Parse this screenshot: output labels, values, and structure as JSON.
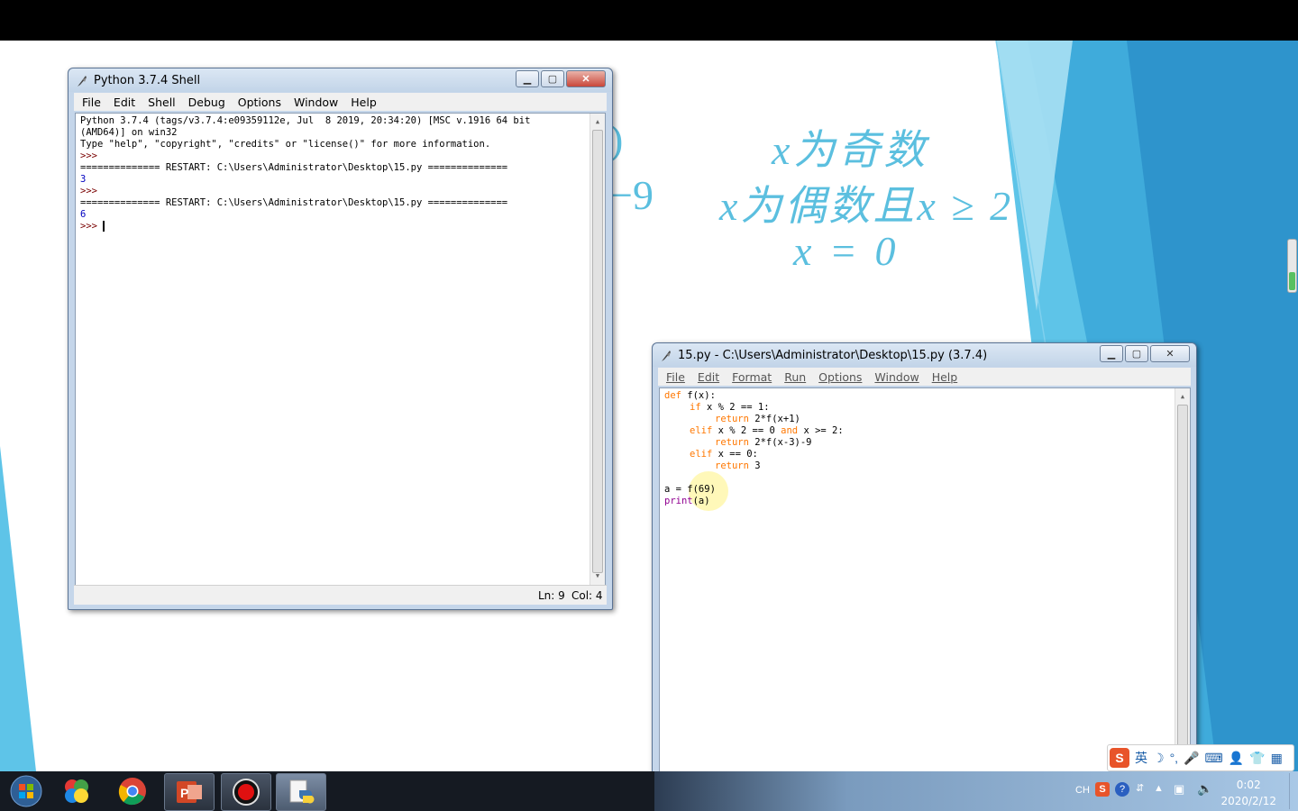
{
  "slide": {
    "frag_paren": ")",
    "frag_minus9": "−9",
    "line1": "x为奇数",
    "line2": "x为偶数且x ≥ 2",
    "line3": "x = 0"
  },
  "shell": {
    "title": "Python 3.7.4 Shell",
    "menu": [
      "File",
      "Edit",
      "Shell",
      "Debug",
      "Options",
      "Window",
      "Help"
    ],
    "lines": [
      "Python 3.7.4 (tags/v3.7.4:e09359112e, Jul  8 2019, 20:34:20) [MSC v.1916 64 bit",
      "(AMD64)] on win32",
      "Type \"help\", \"copyright\", \"credits\" or \"license()\" for more information.",
      ">>> ",
      "============== RESTART: C:\\Users\\Administrator\\Desktop\\15.py ==============",
      "3",
      ">>> ",
      "============== RESTART: C:\\Users\\Administrator\\Desktop\\15.py ==============",
      "6",
      ">>> "
    ],
    "status_ln": "Ln: 9",
    "status_col": "Col: 4"
  },
  "editor": {
    "title": "15.py - C:\\Users\\Administrator\\Desktop\\15.py (3.7.4)",
    "menu": [
      "File",
      "Edit",
      "Format",
      "Run",
      "Options",
      "Window",
      "Help"
    ],
    "code": {
      "l1_kw": "def",
      "l1_rest": " f(x):",
      "l2_kw": "if",
      "l2_rest": " x % 2 == 1:",
      "l3_kw": "return",
      "l3_rest": " 2*f(x+1)",
      "l4_kw": "elif",
      "l4_mid": " x % 2 == 0 ",
      "l4_kw2": "and",
      "l4_rest": " x >= 2:",
      "l5_kw": "return",
      "l5_rest": " 2*f(x-3)-9",
      "l6_kw": "elif",
      "l6_rest": " x == 0:",
      "l7_kw": "return",
      "l7_rest": " 3",
      "l8": "",
      "l9": "a = f(69)",
      "l10_fn": "print",
      "l10_rest": "(a)"
    }
  },
  "tray": {
    "ime_label": "英",
    "lang": "CH",
    "time": "0:02",
    "date": "2020/2/12"
  },
  "colors": {
    "slide_accent": "#5bbfdf",
    "keyword": "#ff7700",
    "builtin": "#900090",
    "shell_output": "#0000c0"
  }
}
